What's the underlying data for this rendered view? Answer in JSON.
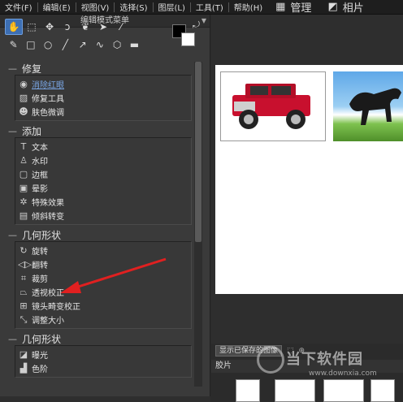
{
  "menubar": {
    "items": [
      "文件(F)",
      "编辑(E)",
      "视图(V)",
      "选择(S)",
      "图层(L)",
      "工具(T)",
      "帮助(H)"
    ],
    "view_tabs": [
      {
        "label": "管理",
        "icon": "grid-icon"
      },
      {
        "label": "相片",
        "icon": "photo-icon"
      }
    ]
  },
  "panel": {
    "title": "编辑模式菜单",
    "tools_row1": [
      "hand-icon",
      "select-icon",
      "move-icon",
      "lasso-icon",
      "brush-icon",
      "pointer-icon",
      "eyedropper-icon"
    ],
    "tools_row2": [
      "pencil-icon",
      "rectangle-icon",
      "ellipse-icon",
      "line-icon",
      "arrow-icon",
      "curve-icon",
      "polygon-icon",
      "gradient-icon"
    ],
    "sections": [
      {
        "title": "修复",
        "items": [
          {
            "label": "消除红眼",
            "icon": "eye-icon",
            "link": true
          },
          {
            "label": "修复工具",
            "icon": "bandage-icon",
            "link": false
          },
          {
            "label": "肤色微调",
            "icon": "face-icon",
            "link": false
          }
        ]
      },
      {
        "title": "添加",
        "items": [
          {
            "label": "文本",
            "icon": "text-icon",
            "link": false
          },
          {
            "label": "水印",
            "icon": "watermark-icon",
            "link": false
          },
          {
            "label": "边框",
            "icon": "frame-icon",
            "link": false
          },
          {
            "label": "晕影",
            "icon": "vignette-icon",
            "link": false
          },
          {
            "label": "特殊效果",
            "icon": "effects-icon",
            "link": false
          },
          {
            "label": "倾斜转变",
            "icon": "tiltshift-icon",
            "link": false
          }
        ]
      },
      {
        "title": "几何形状",
        "items": [
          {
            "label": "旋转",
            "icon": "rotate-icon",
            "link": false
          },
          {
            "label": "翻转",
            "icon": "flip-icon",
            "link": false
          },
          {
            "label": "裁剪",
            "icon": "crop-icon",
            "link": false
          },
          {
            "label": "透视校正",
            "icon": "perspective-icon",
            "link": false
          },
          {
            "label": "镜头畸变校正",
            "icon": "lens-icon",
            "link": false
          },
          {
            "label": "调整大小",
            "icon": "resize-icon",
            "link": false
          }
        ]
      },
      {
        "title": "几何形状",
        "items": [
          {
            "label": "曝光",
            "icon": "exposure-icon",
            "link": false
          },
          {
            "label": "色阶",
            "icon": "levels-icon",
            "link": false
          }
        ]
      }
    ]
  },
  "bottom": {
    "saved_button": "显示已保存的图像",
    "filmstrip_label": "胶片"
  },
  "watermark": {
    "big": "当下软件园",
    "small": "www.downxia.com"
  },
  "colors": {
    "accent": "#3d6fb3",
    "annotation_arrow": "#e02020"
  }
}
